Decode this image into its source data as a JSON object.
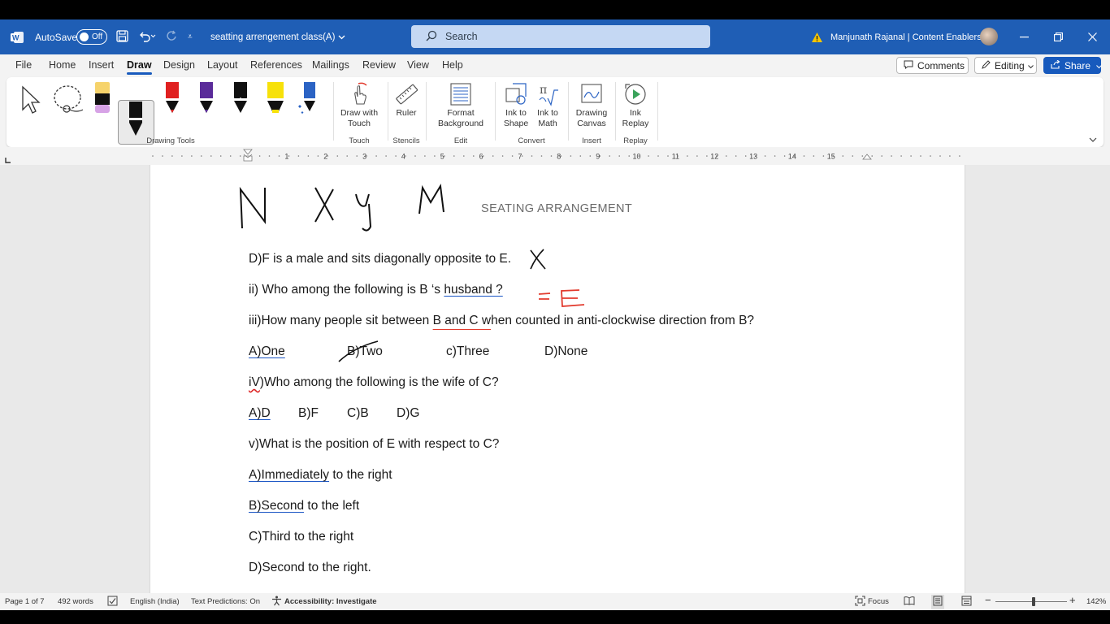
{
  "titlebar": {
    "autosave_label": "AutoSave",
    "autosave_state": "Off",
    "doc_title": "seatting arrengement class(A)",
    "search_placeholder": "Search",
    "user": "Manjunath Rajanal | Content Enablers"
  },
  "menu": {
    "items": [
      "File",
      "Home",
      "Insert",
      "Draw",
      "Design",
      "Layout",
      "References",
      "Mailings",
      "Review",
      "View",
      "Help"
    ],
    "active": "Draw",
    "comments": "Comments",
    "editing": "Editing",
    "share": "Share"
  },
  "ribbon": {
    "draw_with_touch": "Draw with Touch",
    "ruler": "Ruler",
    "format_background": "Format Background",
    "ink_to_shape": "Ink to Shape",
    "ink_to_math": "Ink to Math",
    "drawing_canvas": "Drawing Canvas",
    "ink_replay": "Ink Replay",
    "groups": {
      "drawing_tools": "Drawing Tools",
      "touch": "Touch",
      "stencils": "Stencils",
      "edit": "Edit",
      "convert": "Convert",
      "insert": "Insert",
      "replay": "Replay"
    }
  },
  "ruler_numbers": [
    "1",
    "2",
    "3",
    "4",
    "5",
    "6",
    "7",
    "8",
    "9",
    "10",
    "11",
    "12",
    "13",
    "14",
    "15"
  ],
  "document": {
    "heading": "SEATING ARRANGEMENT",
    "line1": "D)F is a male and sits diagonally opposite to E.",
    "line2_pre": "ii) Who among the following is B ‘s ",
    "line2_u": "husband ?",
    "line3_pre": "iii)How many people sit between ",
    "line3_mid": "B and C w",
    "line3_post": "hen counted in anti-clockwise direction from B?",
    "q3_options": [
      "A)One",
      "B)Two",
      "c)Three",
      "D)None"
    ],
    "line5_pre": "iV",
    "line5_post": ")Who among the following is the wife of C?",
    "q4_options": [
      "A)D",
      "B)F",
      "C)B",
      "D)G"
    ],
    "line7": "v)What is the position of E with respect to C?",
    "ans_a_u": "A)Immediately",
    "ans_a_rest": " to the right",
    "ans_b_u": "B)Second",
    "ans_b_rest": " to the left",
    "ans_c": "C)Third to the right",
    "ans_d": "D)Second to the right."
  },
  "statusbar": {
    "page": "Page 1 of 7",
    "words": "492 words",
    "language": "English (India)",
    "text_predictions": "Text Predictions: On",
    "accessibility": "Accessibility: Investigate",
    "focus": "Focus",
    "zoom": "142%"
  },
  "colors": {
    "titlebar": "#1f5eb5",
    "accent": "#185abd",
    "ink_red": "#e23b2e"
  }
}
